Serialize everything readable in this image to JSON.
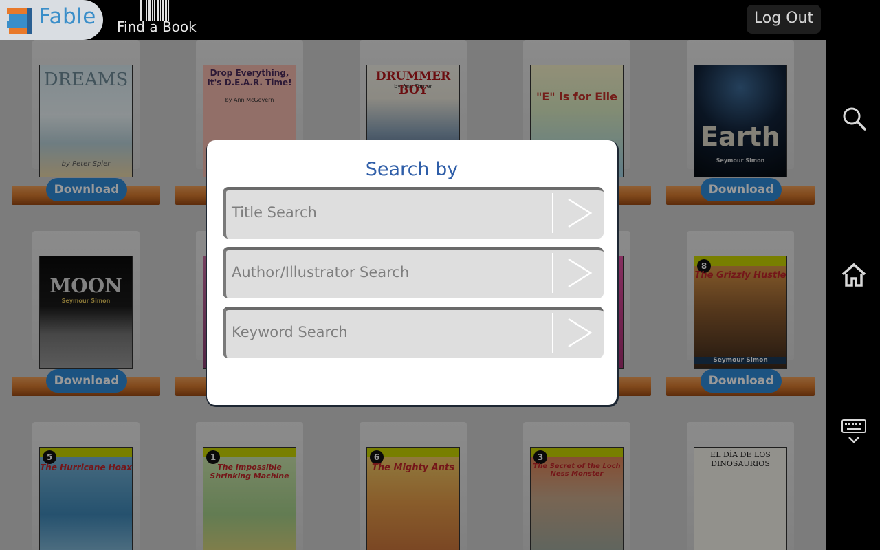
{
  "app": {
    "name": "Fable"
  },
  "topbar": {
    "find_label": "Find a Book",
    "logout_label": "Log Out"
  },
  "sidebar": {
    "items": [
      "search",
      "home",
      "keyboard-hide"
    ]
  },
  "books": [
    {
      "title": "DREAMS",
      "author": "by Peter Spier",
      "button": "Download"
    },
    {
      "title": "Drop Everything, It's D.E.A.R. Time!",
      "author": "by Ann McGovern",
      "button": ""
    },
    {
      "title": "DRUMMER BOY",
      "author": "by Ann Turner",
      "button": ""
    },
    {
      "title": "\"E\" is for Elle",
      "author": "",
      "button": ""
    },
    {
      "title": "Earth",
      "author": "Seymour Simon",
      "button": "Download"
    },
    {
      "title": "MOON",
      "author": "Seymour Simon",
      "button": "Download"
    },
    {
      "title": "The Grizzly Hustle",
      "author": "Seymour Simon",
      "button": "Download",
      "number": "8"
    },
    {
      "title": "The Hurricane Hoax",
      "author": "",
      "number": "5"
    },
    {
      "title": "The Impossible Shrinking Machine",
      "author": "",
      "number": "1"
    },
    {
      "title": "The Mighty Ants",
      "author": "",
      "number": "6"
    },
    {
      "title": "The Secret of the Loch Ness Monster",
      "author": "",
      "number": "3"
    },
    {
      "title": "EL DÍA DE LOS DINOSAURIOS",
      "author": ""
    }
  ],
  "dialog": {
    "title": "Search by",
    "fields": [
      {
        "placeholder": "Title Search"
      },
      {
        "placeholder": "Author/Illustrator Search"
      },
      {
        "placeholder": "Keyword Search"
      }
    ]
  }
}
